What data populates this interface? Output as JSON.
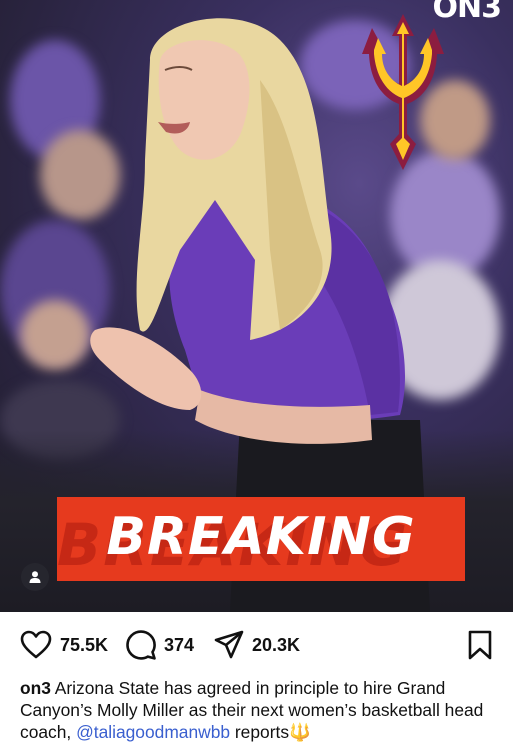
{
  "post": {
    "brand_logo_text": "ON3",
    "banner_text": "BREAKING",
    "banner_shadow_text": "BREAKING",
    "actions": {
      "likes": "75.5K",
      "comments": "374",
      "shares": "20.3K"
    },
    "caption": {
      "username": "on3",
      "text_before_mention": " Arizona State has agreed in principle to hire Grand Canyon’s Molly Miller as their next women’s basketball head coach, ",
      "mention": "@taliagoodmanwbb",
      "text_after_mention": " reports🔱"
    }
  },
  "icons": [
    "heart-icon",
    "comment-icon",
    "share-icon",
    "bookmark-icon",
    "user-tag-icon",
    "pitchfork-logo"
  ],
  "colors": {
    "banner": "#e63a1e",
    "mention": "#3a5fcf",
    "shirt": "#6a3db8",
    "asu_maroon": "#8c1d40",
    "asu_gold": "#ffc627"
  }
}
